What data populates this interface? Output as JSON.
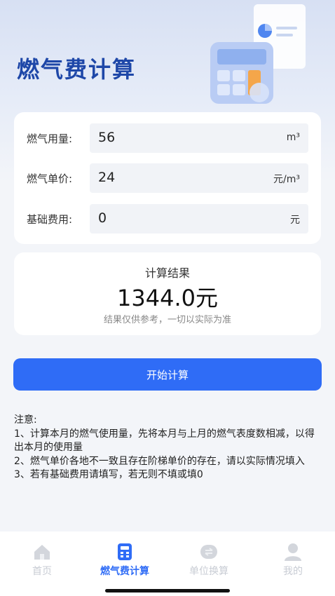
{
  "header": {
    "title": "燃气费计算"
  },
  "form": {
    "rows": [
      {
        "label": "燃气用量:",
        "value": "56",
        "unit": "m³"
      },
      {
        "label": "燃气单价:",
        "value": "24",
        "unit": "元/m³"
      },
      {
        "label": "基础费用:",
        "value": "0",
        "unit": "元"
      }
    ]
  },
  "result": {
    "title": "计算结果",
    "value": "1344.0元",
    "note": "结果仅供参考，一切以实际为准"
  },
  "actions": {
    "start_label": "开始计算"
  },
  "notes": {
    "title": "注意:",
    "lines": [
      "1、计算本月的燃气使用量，先将本月与上月的燃气表度数相减，以得出本月的使用量",
      "2、燃气单价各地不一致且存在阶梯单价的存在，请以实际情况填入",
      "3、若有基础费用请填写，若无则不填或填0"
    ]
  },
  "tabs": [
    {
      "label": "首页",
      "icon": "home-icon",
      "active": false
    },
    {
      "label": "燃气费计算",
      "icon": "calculator-icon",
      "active": true
    },
    {
      "label": "单位换算",
      "icon": "convert-icon",
      "active": false
    },
    {
      "label": "我的",
      "icon": "user-icon",
      "active": false
    }
  ],
  "colors": {
    "accent": "#2f6cf6",
    "title": "#1e47a8",
    "inactive": "#c8ccd4"
  }
}
